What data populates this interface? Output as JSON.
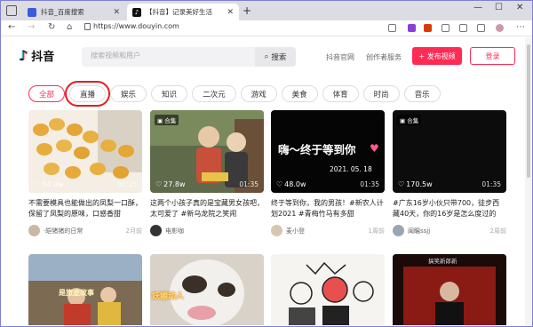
{
  "browser": {
    "tabs": [
      {
        "title": "抖音_百度搜索"
      },
      {
        "title": "【抖音】记录美好生活"
      }
    ],
    "new_tab": "+",
    "url": "https://www.douyin.com"
  },
  "header": {
    "logo_text": "抖音",
    "search_placeholder": "搜索视频和用户",
    "search_button": "搜索",
    "links": [
      "抖音官网",
      "创作者服务"
    ],
    "upload_button": "+ 发布视频",
    "login_button": "登录"
  },
  "categories": [
    "全部",
    "直播",
    "娱乐",
    "知识",
    "二次元",
    "游戏",
    "美食",
    "体育",
    "时尚",
    "音乐"
  ],
  "active_category": "全部",
  "videos": [
    {
      "likes": "54.0w",
      "duration": "01:35",
      "badge": "",
      "desc": "不需要模具也能做出的凤梨一口酥，保留了凤梨的原味，口感香甜",
      "author": "·皑猪猪的日常",
      "time": "2月前",
      "colors": [
        "#f6efe3",
        "#e8b24a"
      ]
    },
    {
      "likes": "27.8w",
      "duration": "01:35",
      "badge": "合集",
      "desc": "这两个小孩子真的是宝藏男女孩吧，太可爱了 #新乌龙院之笑闹",
      "author": "电影咖",
      "time": "",
      "colors": [
        "#4a5a3a",
        "#8a7a5a"
      ]
    },
    {
      "likes": "48.0w",
      "duration": "01:35",
      "badge": "",
      "desc": "终于等到你，我的男孩！#新农人计划2021 #青梅竹马有多甜",
      "author": "麦小登",
      "time": "1周前",
      "colors": [
        "#0a0a0a",
        "#111111"
      ]
    },
    {
      "likes": "170.5w",
      "duration": "01:35",
      "badge": "合集",
      "desc": "#广东16岁小伙只带700，徒步西藏40天，你的16岁是怎么度过的",
      "author": "闽瞩ssjj",
      "time": "2周前",
      "colors": [
        "#101010",
        "#1a1a1a"
      ]
    }
  ],
  "overlay": {
    "video3_text": "嗨～终于等到你",
    "video3_date": "2021. 05. 18",
    "row2_a_text": "是旅途故事",
    "row2_b_text": "妖媚动人",
    "row2_d_text": "搞笑新郎新"
  }
}
